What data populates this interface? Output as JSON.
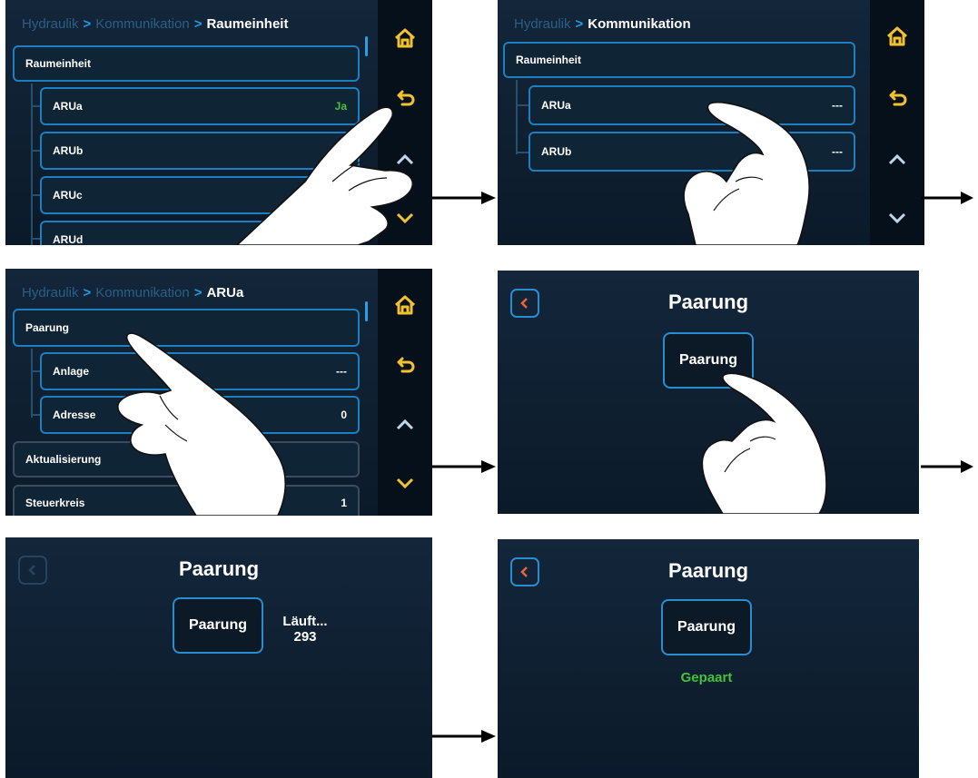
{
  "colors": {
    "accent": "#1e9be8",
    "home_icon": "#f2c12e",
    "back_icon": "#f2c12e",
    "ok_green": "#45c23a",
    "back_arrow": "#e8653a"
  },
  "screen1": {
    "breadcrumb": {
      "p1": "Hydraulik",
      "p2": "Kommunikation",
      "current": "Raumeinheit"
    },
    "header_row": "Raumeinheit",
    "rows": [
      {
        "label": "ARUa",
        "value": "Ja"
      },
      {
        "label": "ARUb",
        "value": ""
      },
      {
        "label": "ARUc",
        "value": ""
      },
      {
        "label": "ARUd",
        "value": ""
      }
    ]
  },
  "screen2": {
    "breadcrumb": {
      "p1": "Hydraulik",
      "current": "Kommunikation"
    },
    "header_row": "Raumeinheit",
    "rows": [
      {
        "label": "ARUa",
        "value": "---"
      },
      {
        "label": "ARUb",
        "value": "---"
      }
    ]
  },
  "screen3": {
    "breadcrumb": {
      "p1": "Hydraulik",
      "p2": "Kommunikation",
      "current": "ARUa"
    },
    "header_row": "Paarung",
    "rows": [
      {
        "label": "Anlage",
        "value": "---"
      },
      {
        "label": "Adresse",
        "value": "0"
      }
    ],
    "row_aktualisierung": "Aktualisierung",
    "row_steuerkreis": {
      "label": "Steuerkreis",
      "value": "1"
    }
  },
  "screen4": {
    "title": "Paarung",
    "button": "Paarung"
  },
  "screen5": {
    "title": "Paarung",
    "button": "Paarung",
    "status_line1": "Läuft...",
    "status_line2": "293"
  },
  "screen6": {
    "title": "Paarung",
    "button": "Paarung",
    "status": "Gepaart"
  },
  "sidebar_icons": [
    "home-icon",
    "return-icon",
    "chevron-up-icon",
    "chevron-down-icon"
  ]
}
